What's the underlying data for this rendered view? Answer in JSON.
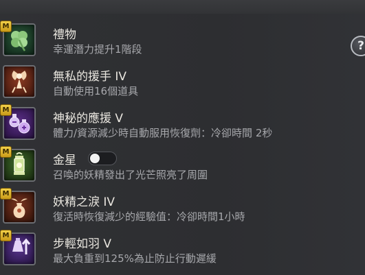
{
  "help": {
    "label": "?"
  },
  "badge_label": "M",
  "items": [
    {
      "icon": "four-leaf-clover-icon",
      "title": "禮物",
      "desc": "幸運潛力提升1階段"
    },
    {
      "icon": "fairy-icon",
      "title": "無私的援手 IV",
      "desc": "自動使用16個道具"
    },
    {
      "icon": "potion-bottles-icon",
      "title": "神秘的應援 V",
      "desc": "體力/資源減少時自動服用恢復劑：冷卻時間 2秒"
    },
    {
      "icon": "lantern-icon",
      "title": "金星",
      "desc": "召喚的妖精發出了光芒照亮了周圍",
      "toggle": "off"
    },
    {
      "icon": "winged-urn-icon",
      "title": "妖精之淚 IV",
      "desc": "復活時恢復減少的經驗值：冷卻時間1小時"
    },
    {
      "icon": "weight-arrow-icon",
      "title": "步輕如羽 V",
      "desc": "最大負重到125%為止防止行動遲緩"
    }
  ]
}
